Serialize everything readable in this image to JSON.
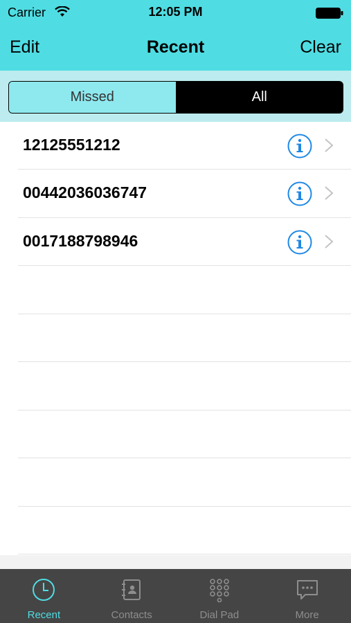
{
  "status_bar": {
    "carrier": "Carrier",
    "time": "12:05 PM"
  },
  "nav": {
    "edit_label": "Edit",
    "title": "Recent",
    "clear_label": "Clear"
  },
  "segment": {
    "missed_label": "Missed",
    "all_label": "All",
    "selected": "All"
  },
  "recents": [
    {
      "number": "12125551212"
    },
    {
      "number": "00442036036747"
    },
    {
      "number": "0017188798946"
    }
  ],
  "tabs": [
    {
      "label": "Recent",
      "icon": "clock-icon",
      "active": true
    },
    {
      "label": "Contacts",
      "icon": "address-book-icon",
      "active": false
    },
    {
      "label": "Dial Pad",
      "icon": "keypad-icon",
      "active": false
    },
    {
      "label": "More",
      "icon": "chat-bubble-icon",
      "active": false
    }
  ],
  "colors": {
    "accent": "#4fdde3",
    "segment_bg": "#bcecef",
    "info_blue": "#1e88e5",
    "tab_bar": "#454545"
  }
}
